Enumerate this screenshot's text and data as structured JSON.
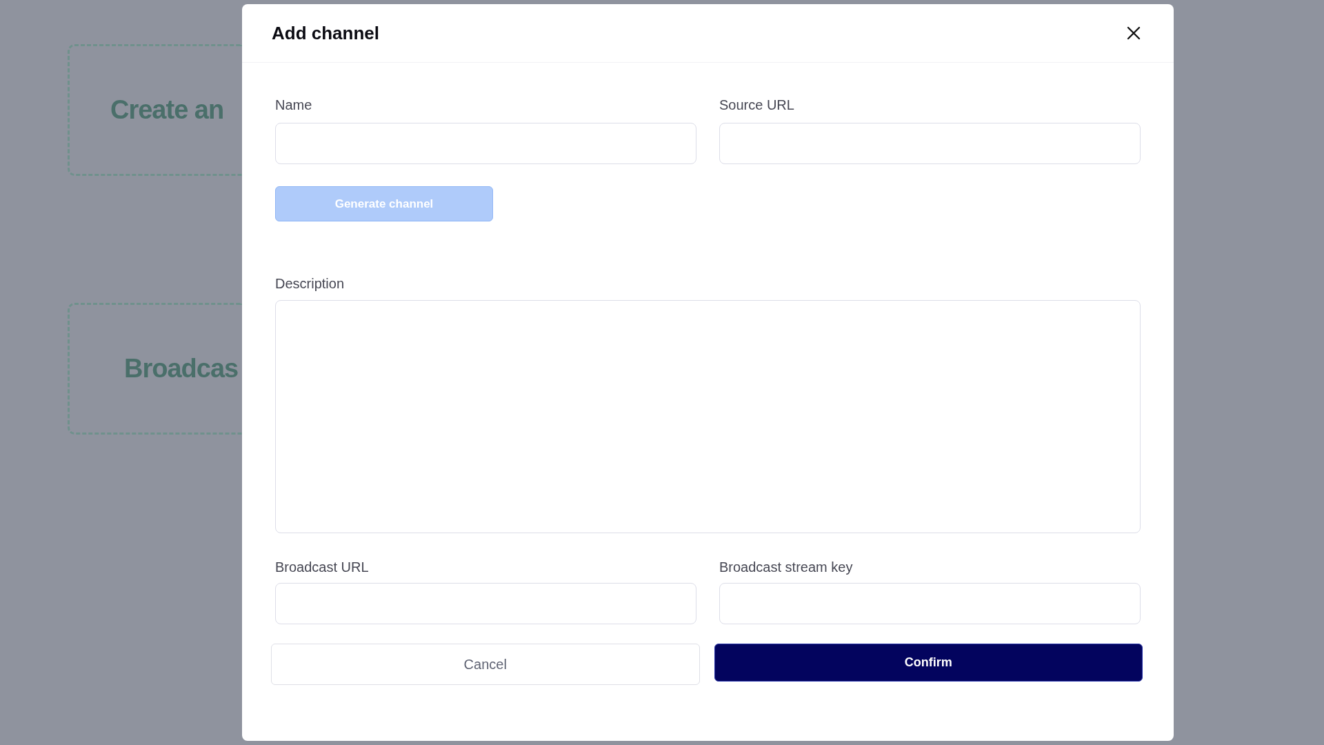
{
  "background": {
    "cards": [
      {
        "title": "Create an"
      },
      {
        "title": "Broadcas"
      }
    ]
  },
  "dialog": {
    "title": "Add channel",
    "source_fields": [
      {
        "label": "Name"
      },
      {
        "label": "Source URL"
      }
    ],
    "generate_button": {
      "label": "Generate channel",
      "disabled": true
    },
    "description": {
      "label": "Description"
    },
    "broadcast_fields": [
      {
        "label": "Broadcast URL"
      },
      {
        "label": "Broadcast stream key"
      }
    ],
    "buttons": [
      {
        "label": "Cancel",
        "kind": "secondary"
      },
      {
        "label": "Confirm",
        "kind": "primary"
      }
    ]
  }
}
